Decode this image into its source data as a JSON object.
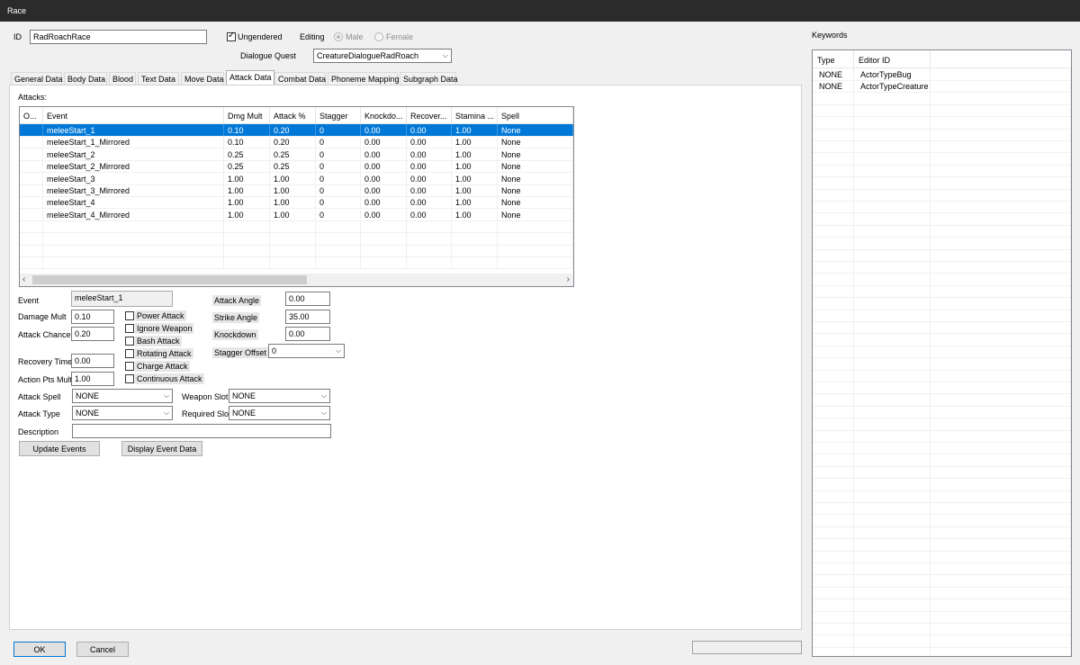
{
  "window": {
    "title": "Race"
  },
  "header": {
    "id_label": "ID",
    "id_value": "RadRoachRace",
    "ungendered_label": "Ungendered",
    "editing_label": "Editing",
    "male_label": "Male",
    "female_label": "Female",
    "dialogue_quest_label": "Dialogue Quest",
    "dialogue_quest_value": "CreatureDialogueRadRoach"
  },
  "keywords": {
    "label": "Keywords",
    "columns": [
      "Type",
      "Editor ID"
    ],
    "rows": [
      [
        "NONE",
        "ActorTypeBug"
      ],
      [
        "NONE",
        "ActorTypeCreature"
      ]
    ]
  },
  "tabs": [
    {
      "label": "General Data"
    },
    {
      "label": "Body Data"
    },
    {
      "label": "Blood"
    },
    {
      "label": "Text Data"
    },
    {
      "label": "Move Data"
    },
    {
      "label": "Attack Data"
    },
    {
      "label": "Combat Data"
    },
    {
      "label": "Phoneme Mapping"
    },
    {
      "label": "Subgraph Data"
    }
  ],
  "attacks": {
    "label": "Attacks:",
    "columns": [
      "O...",
      "Event",
      "Dmg Mult",
      "Attack %",
      "Stagger",
      "Knockdo...",
      "Recover...",
      "Stamina ...",
      "Spell"
    ],
    "rows": [
      [
        "",
        "meleeStart_1",
        "0.10",
        "0.20",
        "0",
        "0.00",
        "0.00",
        "1.00",
        "None"
      ],
      [
        "",
        "meleeStart_1_Mirrored",
        "0.10",
        "0.20",
        "0",
        "0.00",
        "0.00",
        "1.00",
        "None"
      ],
      [
        "",
        "meleeStart_2",
        "0.25",
        "0.25",
        "0",
        "0.00",
        "0.00",
        "1.00",
        "None"
      ],
      [
        "",
        "meleeStart_2_Mirrored",
        "0.25",
        "0.25",
        "0",
        "0.00",
        "0.00",
        "1.00",
        "None"
      ],
      [
        "",
        "meleeStart_3",
        "1.00",
        "1.00",
        "0",
        "0.00",
        "0.00",
        "1.00",
        "None"
      ],
      [
        "",
        "meleeStart_3_Mirrored",
        "1.00",
        "1.00",
        "0",
        "0.00",
        "0.00",
        "1.00",
        "None"
      ],
      [
        "",
        "meleeStart_4",
        "1.00",
        "1.00",
        "0",
        "0.00",
        "0.00",
        "1.00",
        "None"
      ],
      [
        "",
        "meleeStart_4_Mirrored",
        "1.00",
        "1.00",
        "0",
        "0.00",
        "0.00",
        "1.00",
        "None"
      ]
    ]
  },
  "form": {
    "event_label": "Event",
    "event_value": "meleeStart_1",
    "damage_mult_label": "Damage Mult",
    "damage_mult_value": "0.10",
    "attack_chance_label": "Attack Chance",
    "attack_chance_value": "0.20",
    "recovery_time_label": "Recovery Time",
    "recovery_time_value": "0.00",
    "action_pts_label": "Action Pts Mult",
    "action_pts_value": "1.00",
    "power_attack": "Power Attack",
    "ignore_weapon": "Ignore Weapon",
    "bash_attack": "Bash Attack",
    "rotating_attack": "Rotating Attack",
    "charge_attack": "Charge Attack",
    "continuous_attack": "Continuous Attack",
    "attack_angle_label": "Attack Angle",
    "attack_angle_value": "0.00",
    "strike_angle_label": "Strike Angle",
    "strike_angle_value": "35.00",
    "knockdown_label": "Knockdown",
    "knockdown_value": "0.00",
    "stagger_offset_label": "Stagger Offset",
    "stagger_offset_value": "0",
    "attack_spell_label": "Attack Spell",
    "attack_spell_value": "NONE",
    "weapon_slot_label": "Weapon Slot",
    "weapon_slot_value": "NONE",
    "attack_type_label": "Attack Type",
    "attack_type_value": "NONE",
    "required_slot_label": "Required Slot",
    "required_slot_value": "NONE",
    "description_label": "Description",
    "description_value": "",
    "update_events": "Update Events",
    "display_event_data": "Display Event Data"
  },
  "footer": {
    "ok": "OK",
    "cancel": "Cancel"
  }
}
